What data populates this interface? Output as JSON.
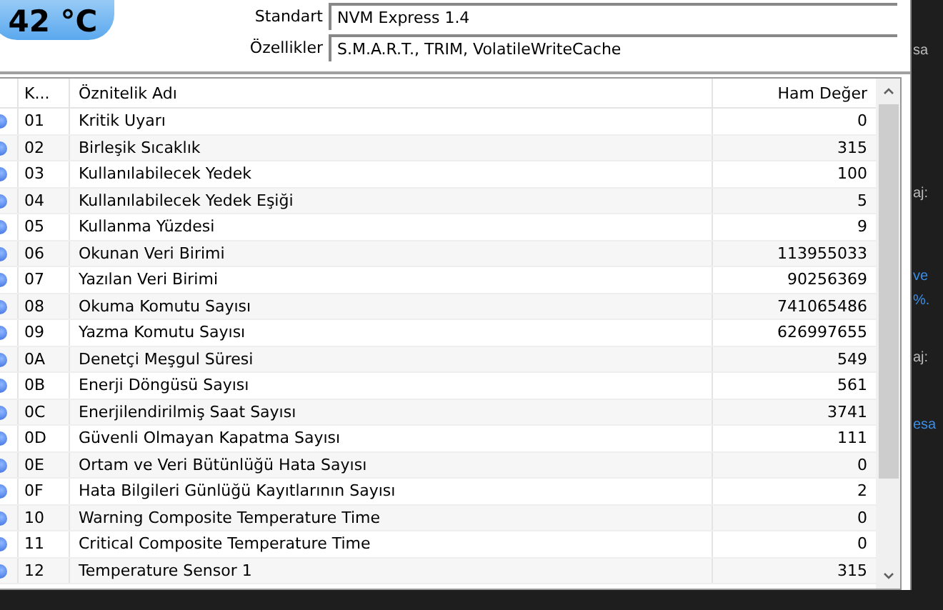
{
  "temperature": "42 °C",
  "fields": [
    {
      "label": "Standart",
      "value": "NVM Express 1.4"
    },
    {
      "label": "Özellikler",
      "value": "S.M.A.R.T., TRIM, VolatileWriteCache"
    }
  ],
  "table": {
    "columns": [
      "K...",
      "Öznitelik Adı",
      "Ham Değer"
    ],
    "rows": [
      [
        "01",
        "Kritik Uyarı",
        "0"
      ],
      [
        "02",
        "Birleşik Sıcaklık",
        "315"
      ],
      [
        "03",
        "Kullanılabilecek Yedek",
        "100"
      ],
      [
        "04",
        "Kullanılabilecek Yedek Eşiği",
        "5"
      ],
      [
        "05",
        "Kullanma Yüzdesi",
        "9"
      ],
      [
        "06",
        "Okunan Veri Birimi",
        "113955033"
      ],
      [
        "07",
        "Yazılan Veri Birimi",
        "90256369"
      ],
      [
        "08",
        "Okuma Komutu Sayısı",
        "741065486"
      ],
      [
        "09",
        "Yazma Komutu Sayısı",
        "626997655"
      ],
      [
        "0A",
        "Denetçi Meşgul Süresi",
        "549"
      ],
      [
        "0B",
        "Enerji Döngüsü Sayısı",
        "561"
      ],
      [
        "0C",
        "Enerjilendirilmiş Saat Sayısı",
        "3741"
      ],
      [
        "0D",
        "Güvenli Olmayan Kapatma Sayısı",
        "111"
      ],
      [
        "0E",
        "Ortam ve Veri Bütünlüğü Hata Sayısı",
        "0"
      ],
      [
        "0F",
        "Hata Bilgileri Günlüğü Kayıtlarının Sayısı",
        "2"
      ],
      [
        "10",
        "Warning Composite Temperature Time",
        "0"
      ],
      [
        "11",
        "Critical Composite Temperature Time",
        "0"
      ],
      [
        "12",
        "Temperature Sensor 1",
        "315"
      ]
    ]
  },
  "background_window": [
    {
      "text": "sa",
      "kind": "plain"
    },
    {
      "text": "aj:",
      "kind": "plain"
    },
    {
      "text": "ve",
      "kind": "link"
    },
    {
      "text": "%.",
      "kind": "link"
    },
    {
      "text": "aj:",
      "kind": "plain"
    },
    {
      "text": "esa",
      "kind": "link"
    }
  ]
}
